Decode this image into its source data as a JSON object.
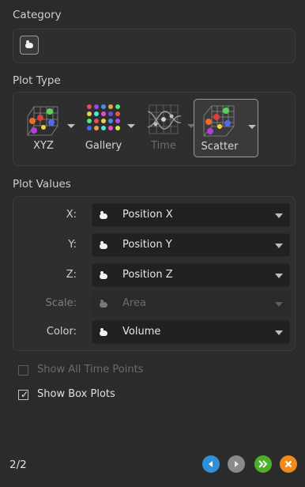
{
  "category": {
    "label": "Category",
    "icon": "blob-icon"
  },
  "plot_type": {
    "label": "Plot Type",
    "items": [
      {
        "name": "XYZ",
        "enabled": true,
        "selected": false
      },
      {
        "name": "Gallery",
        "enabled": true,
        "selected": false
      },
      {
        "name": "Time",
        "enabled": false,
        "selected": false
      },
      {
        "name": "Scatter",
        "enabled": true,
        "selected": true
      }
    ]
  },
  "plot_values": {
    "label": "Plot Values",
    "rows": [
      {
        "label": "X:",
        "value": "Position X",
        "enabled": true
      },
      {
        "label": "Y:",
        "value": "Position Y",
        "enabled": true
      },
      {
        "label": "Z:",
        "value": "Position Z",
        "enabled": true
      },
      {
        "label": "Scale:",
        "value": "Area",
        "enabled": false
      },
      {
        "label": "Color:",
        "value": "Volume",
        "enabled": true
      }
    ]
  },
  "options": {
    "show_all_time_points": {
      "label": "Show All Time Points",
      "checked": false,
      "enabled": false
    },
    "show_box_plots": {
      "label": "Show Box Plots",
      "checked": true,
      "enabled": true
    }
  },
  "footer": {
    "page": "2/2",
    "buttons": [
      {
        "name": "back-icon",
        "color": "#2f8fd8"
      },
      {
        "name": "forward-icon",
        "color": "#8a8a8a"
      },
      {
        "name": "fast-forward-icon",
        "color": "#4caf28"
      },
      {
        "name": "close-icon",
        "color": "#f08a1a"
      }
    ]
  }
}
